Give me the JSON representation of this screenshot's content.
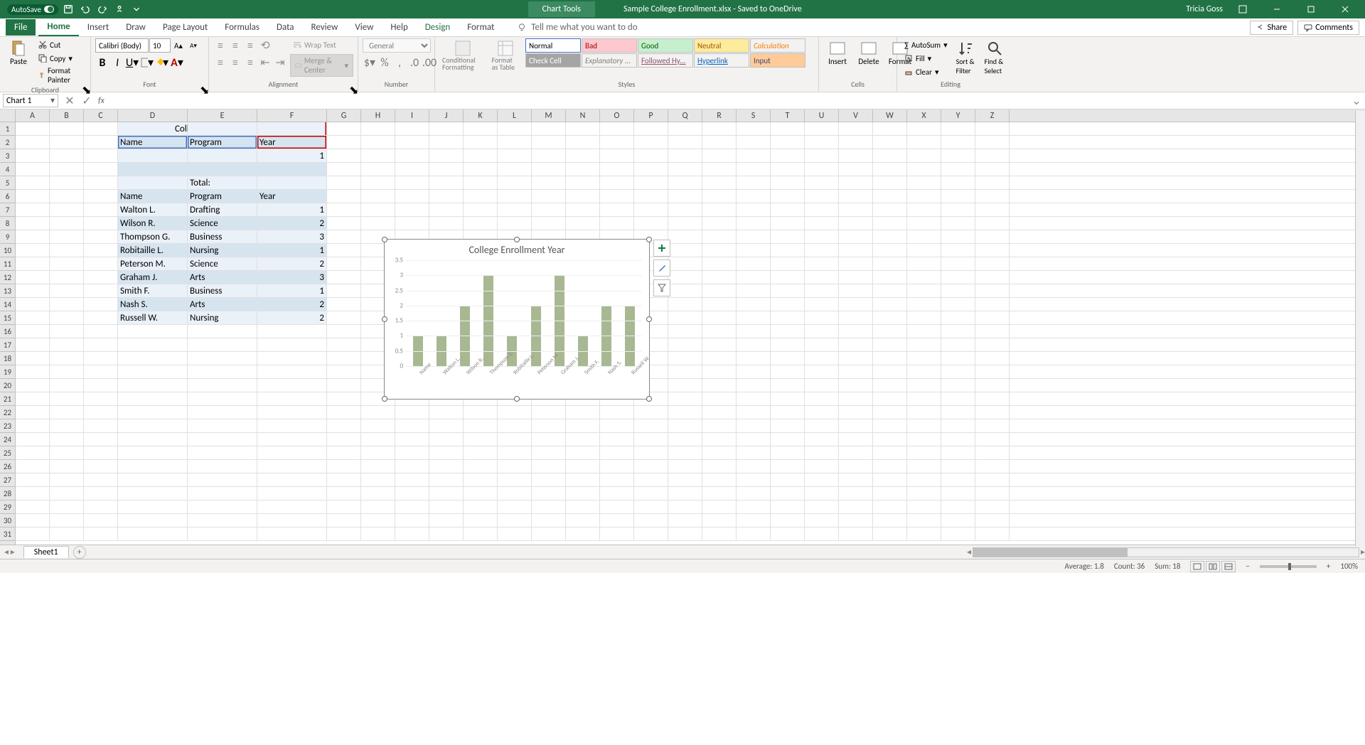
{
  "titlebar": {
    "autosave": "AutoSave",
    "chart_tools": "Chart Tools",
    "doc_title": "Sample College Enrollment.xlsx - Saved to OneDrive",
    "user": "Tricia Goss"
  },
  "tabs": {
    "file": "File",
    "home": "Home",
    "insert": "Insert",
    "draw": "Draw",
    "page_layout": "Page Layout",
    "formulas": "Formulas",
    "data": "Data",
    "review": "Review",
    "view": "View",
    "help": "Help",
    "design": "Design",
    "format": "Format",
    "tellme": "Tell me what you want to do",
    "share": "Share",
    "comments": "Comments"
  },
  "ribbon": {
    "paste": "Paste",
    "cut": "Cut",
    "copy": "Copy",
    "format_painter": "Format Painter",
    "clipboard": "Clipboard",
    "font_name": "Calibri (Body)",
    "font_size": "10",
    "font": "Font",
    "wrap_text": "Wrap Text",
    "merge_center": "Merge & Center",
    "alignment": "Alignment",
    "number_format": "General",
    "number": "Number",
    "cond_format": "Conditional Formatting",
    "format_table": "Format as Table",
    "styles_label": "Styles",
    "styles": {
      "normal": "Normal",
      "bad": "Bad",
      "good": "Good",
      "neutral": "Neutral",
      "calculation": "Calculation",
      "check_cell": "Check Cell",
      "explanatory": "Explanatory ...",
      "followed": "Followed Hy...",
      "hyperlink": "Hyperlink",
      "input": "Input"
    },
    "insert_btn": "Insert",
    "delete_btn": "Delete",
    "format_btn": "Format",
    "cells": "Cells",
    "autosum": "AutoSum",
    "fill": "Fill",
    "clear": "Clear",
    "sort_filter": "Sort & Filter",
    "find_select": "Find & Select",
    "editing": "Editing"
  },
  "name_box": "Chart 1",
  "columns": [
    "A",
    "B",
    "C",
    "D",
    "E",
    "F",
    "G",
    "H",
    "I",
    "J",
    "K",
    "L",
    "M",
    "N",
    "O",
    "P",
    "Q",
    "R",
    "S",
    "T",
    "U",
    "V",
    "W",
    "X",
    "Y",
    "Z"
  ],
  "col_widths": {
    "A": 48,
    "B": 48,
    "C": 48,
    "D": 98,
    "E": 98,
    "F": 98,
    "default": 48
  },
  "data_cells": {
    "title": "College Enrollment",
    "hdr_name": "Name",
    "hdr_program": "Program",
    "hdr_year": "Year",
    "r3_year": "1",
    "total": "Total:",
    "rows": [
      {
        "name": "Walton L.",
        "program": "Drafting",
        "year": "1"
      },
      {
        "name": "Wilson R.",
        "program": "Science",
        "year": "2"
      },
      {
        "name": "Thompson G.",
        "program": "Business",
        "year": "3"
      },
      {
        "name": "Robitaille L.",
        "program": "Nursing",
        "year": "1"
      },
      {
        "name": "Peterson M.",
        "program": "Science",
        "year": "2"
      },
      {
        "name": "Graham J.",
        "program": "Arts",
        "year": "3"
      },
      {
        "name": "Smith F.",
        "program": "Business",
        "year": "1"
      },
      {
        "name": "Nash S.",
        "program": "Arts",
        "year": "2"
      },
      {
        "name": "Russell W.",
        "program": "Nursing",
        "year": "2"
      }
    ]
  },
  "chart_data": {
    "type": "bar",
    "title": "College Enrollment Year",
    "categories": [
      "Name",
      "Walton L.",
      "Wilson R.",
      "Thompson G.",
      "Robitaille L.",
      "Peterson M.",
      "Graham J.",
      "Smith F.",
      "Nash S.",
      "Russell W."
    ],
    "values": [
      1,
      1,
      2,
      3,
      1,
      2,
      3,
      1,
      2,
      2
    ],
    "yticks": [
      0,
      0.5,
      1,
      1.5,
      2,
      2.5,
      3,
      3.5
    ],
    "ylim": [
      0,
      3.5
    ],
    "bar_color": "#a8b892"
  },
  "sheet": {
    "name": "Sheet1"
  },
  "status": {
    "average": "Average: 1.8",
    "count": "Count: 36",
    "sum": "Sum: 18",
    "zoom": "100%"
  }
}
